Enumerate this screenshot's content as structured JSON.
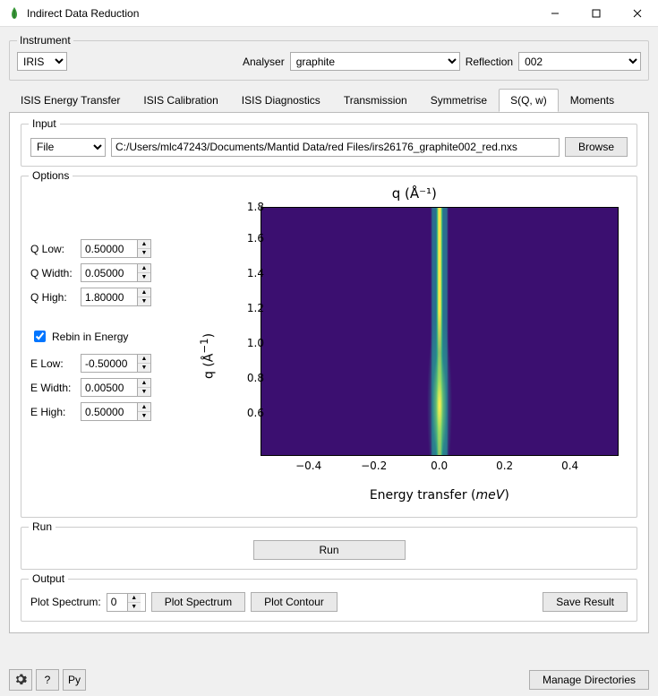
{
  "window": {
    "title": "Indirect Data Reduction"
  },
  "instrument_group": {
    "legend": "Instrument",
    "instrument_value": "IRIS",
    "analyser_label": "Analyser",
    "analyser_value": "graphite",
    "reflection_label": "Reflection",
    "reflection_value": "002"
  },
  "tabs": {
    "items": [
      "ISIS Energy Transfer",
      "ISIS Calibration",
      "ISIS Diagnostics",
      "Transmission",
      "Symmetrise",
      "S(Q, w)",
      "Moments"
    ],
    "active_index": 5
  },
  "input_group": {
    "legend": "Input",
    "source_value": "File",
    "path": "C:/Users/mlc47243/Documents/Mantid Data/red Files/irs26176_graphite002_red.nxs",
    "browse": "Browse"
  },
  "options_group": {
    "legend": "Options",
    "qlow_label": "Q Low:",
    "qlow_value": "0.50000",
    "qwidth_label": "Q Width:",
    "qwidth_value": "0.05000",
    "qhigh_label": "Q High:",
    "qhigh_value": "1.80000",
    "rebin_label": "Rebin in Energy",
    "elow_label": "E Low:",
    "elow_value": "-0.50000",
    "ewidth_label": "E Width:",
    "ewidth_value": "0.00500",
    "ehigh_label": "E High:",
    "ehigh_value": "0.50000"
  },
  "chart_data": {
    "type": "heatmap",
    "title": "q (Å⁻¹)",
    "xlabel": "Energy transfer (meV)",
    "ylabel": "q (Å⁻¹)",
    "xlim": [
      -0.55,
      0.55
    ],
    "ylim": [
      0.45,
      1.85
    ],
    "xticks": [
      -0.4,
      -0.2,
      0.0,
      0.2,
      0.4
    ],
    "yticks": [
      0.6,
      0.8,
      1.0,
      1.2,
      1.4,
      1.6,
      1.8
    ],
    "xtick_labels": [
      "−0.4",
      "−0.2",
      "0.0",
      "0.2",
      "0.4"
    ],
    "ytick_labels": [
      "0.6",
      "0.8",
      "1.0",
      "1.2",
      "1.4",
      "1.6",
      "1.8"
    ],
    "colormap": "viridis",
    "note": "Intensity concentrated around energy transfer ≈ 0, highest at low q; S(Q,ω) colour plot"
  },
  "run_group": {
    "legend": "Run",
    "run_label": "Run"
  },
  "output_group": {
    "legend": "Output",
    "plot_spectrum_label": "Plot Spectrum:",
    "plot_spectrum_value": "0",
    "plot_spectrum_btn": "Plot Spectrum",
    "plot_contour_btn": "Plot Contour",
    "save_btn": "Save Result"
  },
  "footer": {
    "help": "?",
    "py": "Py",
    "manage": "Manage Directories"
  }
}
